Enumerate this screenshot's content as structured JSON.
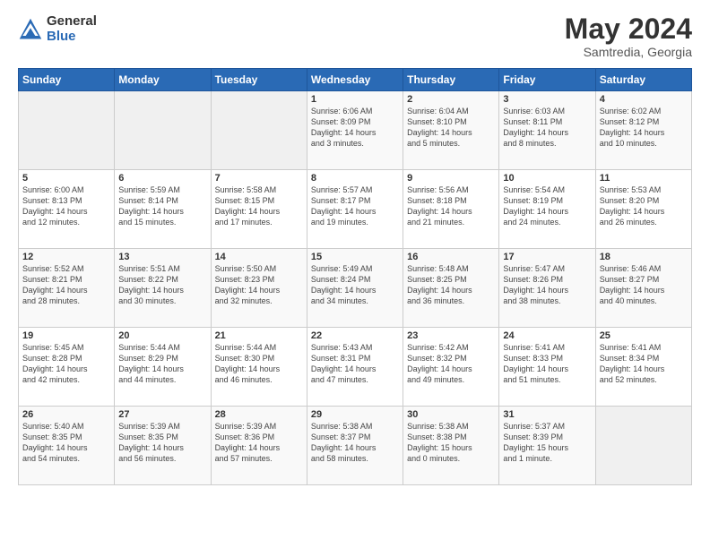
{
  "header": {
    "logo_general": "General",
    "logo_blue": "Blue",
    "title": "May 2024",
    "location": "Samtredia, Georgia"
  },
  "days_of_week": [
    "Sunday",
    "Monday",
    "Tuesday",
    "Wednesday",
    "Thursday",
    "Friday",
    "Saturday"
  ],
  "weeks": [
    [
      {
        "day": "",
        "info": ""
      },
      {
        "day": "",
        "info": ""
      },
      {
        "day": "",
        "info": ""
      },
      {
        "day": "1",
        "info": "Sunrise: 6:06 AM\nSunset: 8:09 PM\nDaylight: 14 hours\nand 3 minutes."
      },
      {
        "day": "2",
        "info": "Sunrise: 6:04 AM\nSunset: 8:10 PM\nDaylight: 14 hours\nand 5 minutes."
      },
      {
        "day": "3",
        "info": "Sunrise: 6:03 AM\nSunset: 8:11 PM\nDaylight: 14 hours\nand 8 minutes."
      },
      {
        "day": "4",
        "info": "Sunrise: 6:02 AM\nSunset: 8:12 PM\nDaylight: 14 hours\nand 10 minutes."
      }
    ],
    [
      {
        "day": "5",
        "info": "Sunrise: 6:00 AM\nSunset: 8:13 PM\nDaylight: 14 hours\nand 12 minutes."
      },
      {
        "day": "6",
        "info": "Sunrise: 5:59 AM\nSunset: 8:14 PM\nDaylight: 14 hours\nand 15 minutes."
      },
      {
        "day": "7",
        "info": "Sunrise: 5:58 AM\nSunset: 8:15 PM\nDaylight: 14 hours\nand 17 minutes."
      },
      {
        "day": "8",
        "info": "Sunrise: 5:57 AM\nSunset: 8:17 PM\nDaylight: 14 hours\nand 19 minutes."
      },
      {
        "day": "9",
        "info": "Sunrise: 5:56 AM\nSunset: 8:18 PM\nDaylight: 14 hours\nand 21 minutes."
      },
      {
        "day": "10",
        "info": "Sunrise: 5:54 AM\nSunset: 8:19 PM\nDaylight: 14 hours\nand 24 minutes."
      },
      {
        "day": "11",
        "info": "Sunrise: 5:53 AM\nSunset: 8:20 PM\nDaylight: 14 hours\nand 26 minutes."
      }
    ],
    [
      {
        "day": "12",
        "info": "Sunrise: 5:52 AM\nSunset: 8:21 PM\nDaylight: 14 hours\nand 28 minutes."
      },
      {
        "day": "13",
        "info": "Sunrise: 5:51 AM\nSunset: 8:22 PM\nDaylight: 14 hours\nand 30 minutes."
      },
      {
        "day": "14",
        "info": "Sunrise: 5:50 AM\nSunset: 8:23 PM\nDaylight: 14 hours\nand 32 minutes."
      },
      {
        "day": "15",
        "info": "Sunrise: 5:49 AM\nSunset: 8:24 PM\nDaylight: 14 hours\nand 34 minutes."
      },
      {
        "day": "16",
        "info": "Sunrise: 5:48 AM\nSunset: 8:25 PM\nDaylight: 14 hours\nand 36 minutes."
      },
      {
        "day": "17",
        "info": "Sunrise: 5:47 AM\nSunset: 8:26 PM\nDaylight: 14 hours\nand 38 minutes."
      },
      {
        "day": "18",
        "info": "Sunrise: 5:46 AM\nSunset: 8:27 PM\nDaylight: 14 hours\nand 40 minutes."
      }
    ],
    [
      {
        "day": "19",
        "info": "Sunrise: 5:45 AM\nSunset: 8:28 PM\nDaylight: 14 hours\nand 42 minutes."
      },
      {
        "day": "20",
        "info": "Sunrise: 5:44 AM\nSunset: 8:29 PM\nDaylight: 14 hours\nand 44 minutes."
      },
      {
        "day": "21",
        "info": "Sunrise: 5:44 AM\nSunset: 8:30 PM\nDaylight: 14 hours\nand 46 minutes."
      },
      {
        "day": "22",
        "info": "Sunrise: 5:43 AM\nSunset: 8:31 PM\nDaylight: 14 hours\nand 47 minutes."
      },
      {
        "day": "23",
        "info": "Sunrise: 5:42 AM\nSunset: 8:32 PM\nDaylight: 14 hours\nand 49 minutes."
      },
      {
        "day": "24",
        "info": "Sunrise: 5:41 AM\nSunset: 8:33 PM\nDaylight: 14 hours\nand 51 minutes."
      },
      {
        "day": "25",
        "info": "Sunrise: 5:41 AM\nSunset: 8:34 PM\nDaylight: 14 hours\nand 52 minutes."
      }
    ],
    [
      {
        "day": "26",
        "info": "Sunrise: 5:40 AM\nSunset: 8:35 PM\nDaylight: 14 hours\nand 54 minutes."
      },
      {
        "day": "27",
        "info": "Sunrise: 5:39 AM\nSunset: 8:35 PM\nDaylight: 14 hours\nand 56 minutes."
      },
      {
        "day": "28",
        "info": "Sunrise: 5:39 AM\nSunset: 8:36 PM\nDaylight: 14 hours\nand 57 minutes."
      },
      {
        "day": "29",
        "info": "Sunrise: 5:38 AM\nSunset: 8:37 PM\nDaylight: 14 hours\nand 58 minutes."
      },
      {
        "day": "30",
        "info": "Sunrise: 5:38 AM\nSunset: 8:38 PM\nDaylight: 15 hours\nand 0 minutes."
      },
      {
        "day": "31",
        "info": "Sunrise: 5:37 AM\nSunset: 8:39 PM\nDaylight: 15 hours\nand 1 minute."
      },
      {
        "day": "",
        "info": ""
      }
    ]
  ]
}
